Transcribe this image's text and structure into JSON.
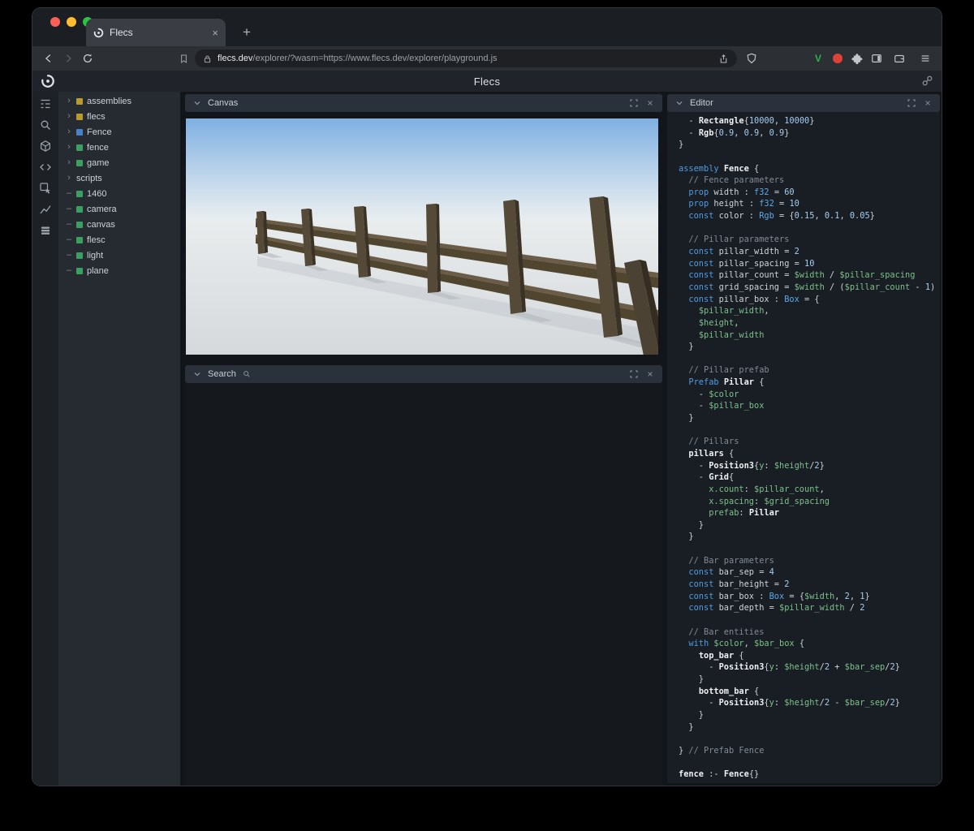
{
  "browser": {
    "tab_title": "Flecs",
    "new_tab": "+",
    "url_host": "flecs.dev",
    "url_path": "/explorer/?wasm=https://www.flecs.dev/explorer/playground.js",
    "extension_badge": "V",
    "icons": [
      "back-icon",
      "forward-icon",
      "reload-icon",
      "bookmark-icon",
      "lock-icon",
      "share-icon",
      "shield-icon",
      "extension-v-icon",
      "extension-red-icon",
      "puzzle-icon",
      "sidebar-toggle-icon",
      "wallet-icon",
      "menu-icon"
    ]
  },
  "app": {
    "title": "Flecs"
  },
  "explorer_toolbar": {
    "icons": [
      "hierarchy-icon",
      "search-icon",
      "entities-icon",
      "code-icon",
      "inspect-icon",
      "stats-icon",
      "memory-icon"
    ]
  },
  "tree": {
    "items": [
      {
        "label": "assemblies",
        "color": "#b99a30",
        "expandable": true
      },
      {
        "label": "flecs",
        "color": "#b99a30",
        "expandable": true
      },
      {
        "label": "Fence",
        "color": "#4a82c8",
        "expandable": true
      },
      {
        "label": "fence",
        "color": "#3d9e62",
        "expandable": true
      },
      {
        "label": "game",
        "color": "#3d9e62",
        "expandable": true
      },
      {
        "label": "scripts",
        "color": null,
        "expandable": true
      },
      {
        "label": "1460",
        "color": "#3d9e62",
        "expandable": false
      },
      {
        "label": "camera",
        "color": "#3d9e62",
        "expandable": false
      },
      {
        "label": "canvas",
        "color": "#3d9e62",
        "expandable": false
      },
      {
        "label": "flesc",
        "color": "#3d9e62",
        "expandable": false
      },
      {
        "label": "light",
        "color": "#3d9e62",
        "expandable": false
      },
      {
        "label": "plane",
        "color": "#3d9e62",
        "expandable": false
      }
    ]
  },
  "panels": {
    "canvas": {
      "title": "Canvas"
    },
    "search": {
      "title": "Search"
    },
    "editor": {
      "title": "Editor"
    }
  },
  "code": {
    "lines": [
      [
        [
          "p",
          "  - "
        ],
        [
          "b",
          "Rectangle"
        ],
        [
          "p",
          "{"
        ],
        [
          "n",
          "10000"
        ],
        [
          "p",
          ", "
        ],
        [
          "n",
          "10000"
        ],
        [
          "p",
          "}"
        ]
      ],
      [
        [
          "p",
          "  - "
        ],
        [
          "b",
          "Rgb"
        ],
        [
          "p",
          "{"
        ],
        [
          "n",
          "0.9"
        ],
        [
          "p",
          ", "
        ],
        [
          "n",
          "0.9"
        ],
        [
          "p",
          ", "
        ],
        [
          "n",
          "0.9"
        ],
        [
          "p",
          "}"
        ]
      ],
      [
        [
          "p",
          "}"
        ]
      ],
      [],
      [
        [
          "k",
          "assembly"
        ],
        [
          "p",
          " "
        ],
        [
          "b",
          "Fence"
        ],
        [
          "p",
          " {"
        ]
      ],
      [
        [
          "c",
          "  // Fence parameters"
        ]
      ],
      [
        [
          "p",
          "  "
        ],
        [
          "k",
          "prop"
        ],
        [
          "p",
          " width : "
        ],
        [
          "t",
          "f32"
        ],
        [
          "p",
          " = "
        ],
        [
          "n",
          "60"
        ]
      ],
      [
        [
          "p",
          "  "
        ],
        [
          "k",
          "prop"
        ],
        [
          "p",
          " height : "
        ],
        [
          "t",
          "f32"
        ],
        [
          "p",
          " = "
        ],
        [
          "n",
          "10"
        ]
      ],
      [
        [
          "p",
          "  "
        ],
        [
          "k",
          "const"
        ],
        [
          "p",
          " color : "
        ],
        [
          "t",
          "Rgb"
        ],
        [
          "p",
          " = {"
        ],
        [
          "n",
          "0.15"
        ],
        [
          "p",
          ", "
        ],
        [
          "n",
          "0.1"
        ],
        [
          "p",
          ", "
        ],
        [
          "n",
          "0.05"
        ],
        [
          "p",
          "}"
        ]
      ],
      [],
      [
        [
          "c",
          "  // Pillar parameters"
        ]
      ],
      [
        [
          "p",
          "  "
        ],
        [
          "k",
          "const"
        ],
        [
          "p",
          " pillar_width = "
        ],
        [
          "n",
          "2"
        ]
      ],
      [
        [
          "p",
          "  "
        ],
        [
          "k",
          "const"
        ],
        [
          "p",
          " pillar_spacing = "
        ],
        [
          "n",
          "10"
        ]
      ],
      [
        [
          "p",
          "  "
        ],
        [
          "k",
          "const"
        ],
        [
          "p",
          " pillar_count = "
        ],
        [
          "v",
          "$width"
        ],
        [
          "p",
          " / "
        ],
        [
          "v",
          "$pillar_spacing"
        ]
      ],
      [
        [
          "p",
          "  "
        ],
        [
          "k",
          "const"
        ],
        [
          "p",
          " grid_spacing = "
        ],
        [
          "v",
          "$width"
        ],
        [
          "p",
          " / ("
        ],
        [
          "v",
          "$pillar_count"
        ],
        [
          "p",
          " - "
        ],
        [
          "n",
          "1"
        ],
        [
          "p",
          ")"
        ]
      ],
      [
        [
          "p",
          "  "
        ],
        [
          "k",
          "const"
        ],
        [
          "p",
          " pillar_box : "
        ],
        [
          "t",
          "Box"
        ],
        [
          "p",
          " = {"
        ]
      ],
      [
        [
          "p",
          "    "
        ],
        [
          "v",
          "$pillar_width"
        ],
        [
          "p",
          ","
        ]
      ],
      [
        [
          "p",
          "    "
        ],
        [
          "v",
          "$height"
        ],
        [
          "p",
          ","
        ]
      ],
      [
        [
          "p",
          "    "
        ],
        [
          "v",
          "$pillar_width"
        ]
      ],
      [
        [
          "p",
          "  }"
        ]
      ],
      [],
      [
        [
          "c",
          "  // Pillar prefab"
        ]
      ],
      [
        [
          "p",
          "  "
        ],
        [
          "k",
          "Prefab"
        ],
        [
          "p",
          " "
        ],
        [
          "b",
          "Pillar"
        ],
        [
          "p",
          " {"
        ]
      ],
      [
        [
          "p",
          "    - "
        ],
        [
          "v",
          "$color"
        ]
      ],
      [
        [
          "p",
          "    - "
        ],
        [
          "v",
          "$pillar_box"
        ]
      ],
      [
        [
          "p",
          "  }"
        ]
      ],
      [],
      [
        [
          "c",
          "  // Pillars"
        ]
      ],
      [
        [
          "p",
          "  "
        ],
        [
          "b",
          "pillars"
        ],
        [
          "p",
          " {"
        ]
      ],
      [
        [
          "p",
          "    - "
        ],
        [
          "b",
          "Position3"
        ],
        [
          "p",
          "{"
        ],
        [
          "m",
          "y"
        ],
        [
          "p",
          ": "
        ],
        [
          "v",
          "$height"
        ],
        [
          "p",
          "/"
        ],
        [
          "n",
          "2"
        ],
        [
          "p",
          "}"
        ]
      ],
      [
        [
          "p",
          "    - "
        ],
        [
          "b",
          "Grid"
        ],
        [
          "p",
          "{"
        ]
      ],
      [
        [
          "p",
          "      "
        ],
        [
          "m",
          "x.count"
        ],
        [
          "p",
          ": "
        ],
        [
          "v",
          "$pillar_count"
        ],
        [
          "p",
          ","
        ]
      ],
      [
        [
          "p",
          "      "
        ],
        [
          "m",
          "x.spacing"
        ],
        [
          "p",
          ": "
        ],
        [
          "v",
          "$grid_spacing"
        ]
      ],
      [
        [
          "p",
          "      "
        ],
        [
          "m",
          "prefab"
        ],
        [
          "p",
          ": "
        ],
        [
          "b",
          "Pillar"
        ]
      ],
      [
        [
          "p",
          "    }"
        ]
      ],
      [
        [
          "p",
          "  }"
        ]
      ],
      [],
      [
        [
          "c",
          "  // Bar parameters"
        ]
      ],
      [
        [
          "p",
          "  "
        ],
        [
          "k",
          "const"
        ],
        [
          "p",
          " bar_sep = "
        ],
        [
          "n",
          "4"
        ]
      ],
      [
        [
          "p",
          "  "
        ],
        [
          "k",
          "const"
        ],
        [
          "p",
          " bar_height = "
        ],
        [
          "n",
          "2"
        ]
      ],
      [
        [
          "p",
          "  "
        ],
        [
          "k",
          "const"
        ],
        [
          "p",
          " bar_box : "
        ],
        [
          "t",
          "Box"
        ],
        [
          "p",
          " = {"
        ],
        [
          "v",
          "$width"
        ],
        [
          "p",
          ", "
        ],
        [
          "n",
          "2"
        ],
        [
          "p",
          ", "
        ],
        [
          "n",
          "1"
        ],
        [
          "p",
          "}"
        ]
      ],
      [
        [
          "p",
          "  "
        ],
        [
          "k",
          "const"
        ],
        [
          "p",
          " bar_depth = "
        ],
        [
          "v",
          "$pillar_width"
        ],
        [
          "p",
          " / "
        ],
        [
          "n",
          "2"
        ]
      ],
      [],
      [
        [
          "c",
          "  // Bar entities"
        ]
      ],
      [
        [
          "p",
          "  "
        ],
        [
          "k",
          "with"
        ],
        [
          "p",
          " "
        ],
        [
          "v",
          "$color"
        ],
        [
          "p",
          ", "
        ],
        [
          "v",
          "$bar_box"
        ],
        [
          "p",
          " {"
        ]
      ],
      [
        [
          "p",
          "    "
        ],
        [
          "b",
          "top_bar"
        ],
        [
          "p",
          " {"
        ]
      ],
      [
        [
          "p",
          "      - "
        ],
        [
          "b",
          "Position3"
        ],
        [
          "p",
          "{"
        ],
        [
          "m",
          "y"
        ],
        [
          "p",
          ": "
        ],
        [
          "v",
          "$height"
        ],
        [
          "p",
          "/"
        ],
        [
          "n",
          "2"
        ],
        [
          "p",
          " + "
        ],
        [
          "v",
          "$bar_sep"
        ],
        [
          "p",
          "/"
        ],
        [
          "n",
          "2"
        ],
        [
          "p",
          "}"
        ]
      ],
      [
        [
          "p",
          "    }"
        ]
      ],
      [
        [
          "p",
          "    "
        ],
        [
          "b",
          "bottom_bar"
        ],
        [
          "p",
          " {"
        ]
      ],
      [
        [
          "p",
          "      - "
        ],
        [
          "b",
          "Position3"
        ],
        [
          "p",
          "{"
        ],
        [
          "m",
          "y"
        ],
        [
          "p",
          ": "
        ],
        [
          "v",
          "$height"
        ],
        [
          "p",
          "/"
        ],
        [
          "n",
          "2"
        ],
        [
          "p",
          " - "
        ],
        [
          "v",
          "$bar_sep"
        ],
        [
          "p",
          "/"
        ],
        [
          "n",
          "2"
        ],
        [
          "p",
          "}"
        ]
      ],
      [
        [
          "p",
          "    }"
        ]
      ],
      [
        [
          "p",
          "  }"
        ]
      ],
      [],
      [
        [
          "p",
          "} "
        ],
        [
          "c",
          "// Prefab Fence"
        ]
      ],
      [],
      [
        [
          "b",
          "fence"
        ],
        [
          "p",
          " :- "
        ],
        [
          "b",
          "Fence"
        ],
        [
          "p",
          "{}"
        ]
      ]
    ]
  }
}
